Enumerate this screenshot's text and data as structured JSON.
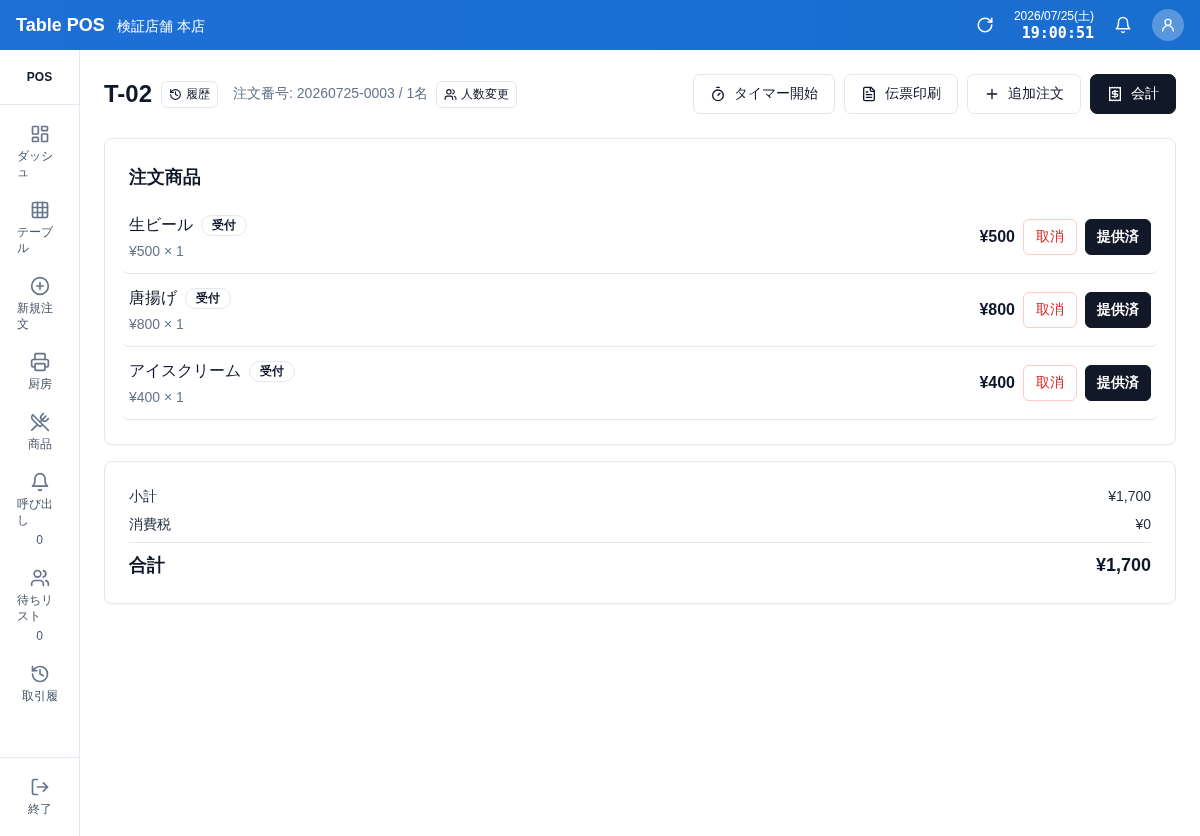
{
  "header": {
    "app_title": "Table POS",
    "store_name": "検証店舗 本店",
    "date": "2026/07/25(土)",
    "time": "19:00:51"
  },
  "sidebar": {
    "title": "POS",
    "items": [
      {
        "label": "ダッシュ",
        "selected": false
      },
      {
        "label": "テーブル",
        "selected": false
      },
      {
        "label": "新規注文",
        "selected": false
      },
      {
        "label": "厨房",
        "selected": false
      },
      {
        "label": "商品",
        "selected": false
      },
      {
        "label": "呼び出し",
        "count": "0",
        "selected": false
      },
      {
        "label": "待ちリスト",
        "count": "0",
        "selected": false
      },
      {
        "label": "取引履",
        "selected": false
      }
    ],
    "footer_item": {
      "label": "終了"
    }
  },
  "order": {
    "table": "T-02",
    "history_button": "履歴",
    "order_info": "注文番号: 20260725-0003 / 1名",
    "guests_button": "人数変更",
    "actions": [
      {
        "label": "タイマー開始",
        "kind": "outline"
      },
      {
        "label": "伝票印刷",
        "kind": "outline"
      },
      {
        "label": "追加注文",
        "kind": "outline"
      },
      {
        "label": "会計",
        "kind": "primary"
      }
    ]
  },
  "order_items": {
    "title": "注文商品",
    "items": [
      {
        "name": "生ビール",
        "status": "受付",
        "unit_line": "¥500 × 1",
        "price": "¥500",
        "cancel_button": "取消",
        "serve_button": "提供済"
      },
      {
        "name": "唐揚げ",
        "status": "受付",
        "unit_line": "¥800 × 1",
        "price": "¥800",
        "cancel_button": "取消",
        "serve_button": "提供済"
      },
      {
        "name": "アイスクリーム",
        "status": "受付",
        "unit_line": "¥400 × 1",
        "price": "¥400",
        "cancel_button": "取消",
        "serve_button": "提供済"
      }
    ]
  },
  "totals": {
    "rows": [
      {
        "label": "小計",
        "value": "¥1,700",
        "kind": "sub"
      },
      {
        "label": "消費税",
        "value": "¥0",
        "kind": "sub"
      },
      {
        "label": "合計",
        "value": "¥1,700",
        "kind": "total"
      }
    ]
  }
}
